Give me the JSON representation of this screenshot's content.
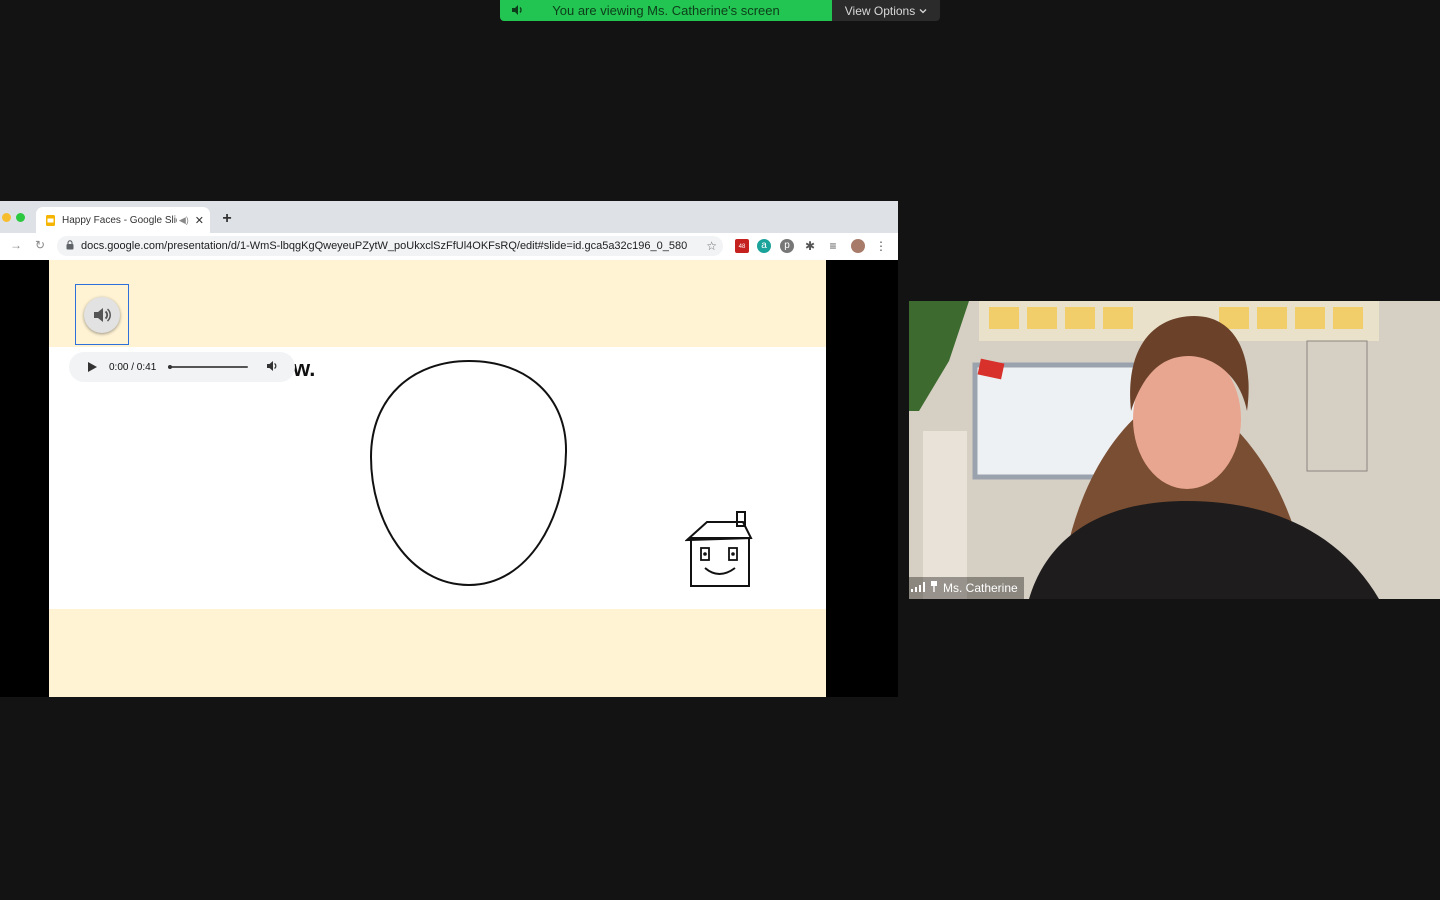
{
  "zoom": {
    "banner_text": "You are viewing Ms. Catherine's screen",
    "view_options_label": "View Options",
    "participant_name": "Ms. Catherine"
  },
  "browser": {
    "tab_title": "Happy Faces - Google Slides",
    "url": "docs.google.com/presentation/d/1-WmS-lbqgKgQweyeuPZytW_poUkxclSzFfUl4OKFsRQ/edit#slide=id.gca5a32c196_0_580",
    "extension_badge": "48"
  },
  "slide": {
    "visible_word_fragment": "w.",
    "audio": {
      "time_display": "0:00 / 0:41",
      "progress": 0
    }
  },
  "colors": {
    "banner_green": "#23c552",
    "slide_cream": "#fff3d4",
    "selection_blue": "#2f6fdc",
    "zoom_background": "#131313"
  },
  "icons": [
    "speaker-icon",
    "chevron-down-icon",
    "favicon-slides-icon",
    "mute-icon",
    "close-icon",
    "plus-icon",
    "back-icon",
    "reload-icon",
    "lock-icon",
    "star-icon",
    "extension-icon",
    "signal-icon",
    "pin-icon"
  ]
}
